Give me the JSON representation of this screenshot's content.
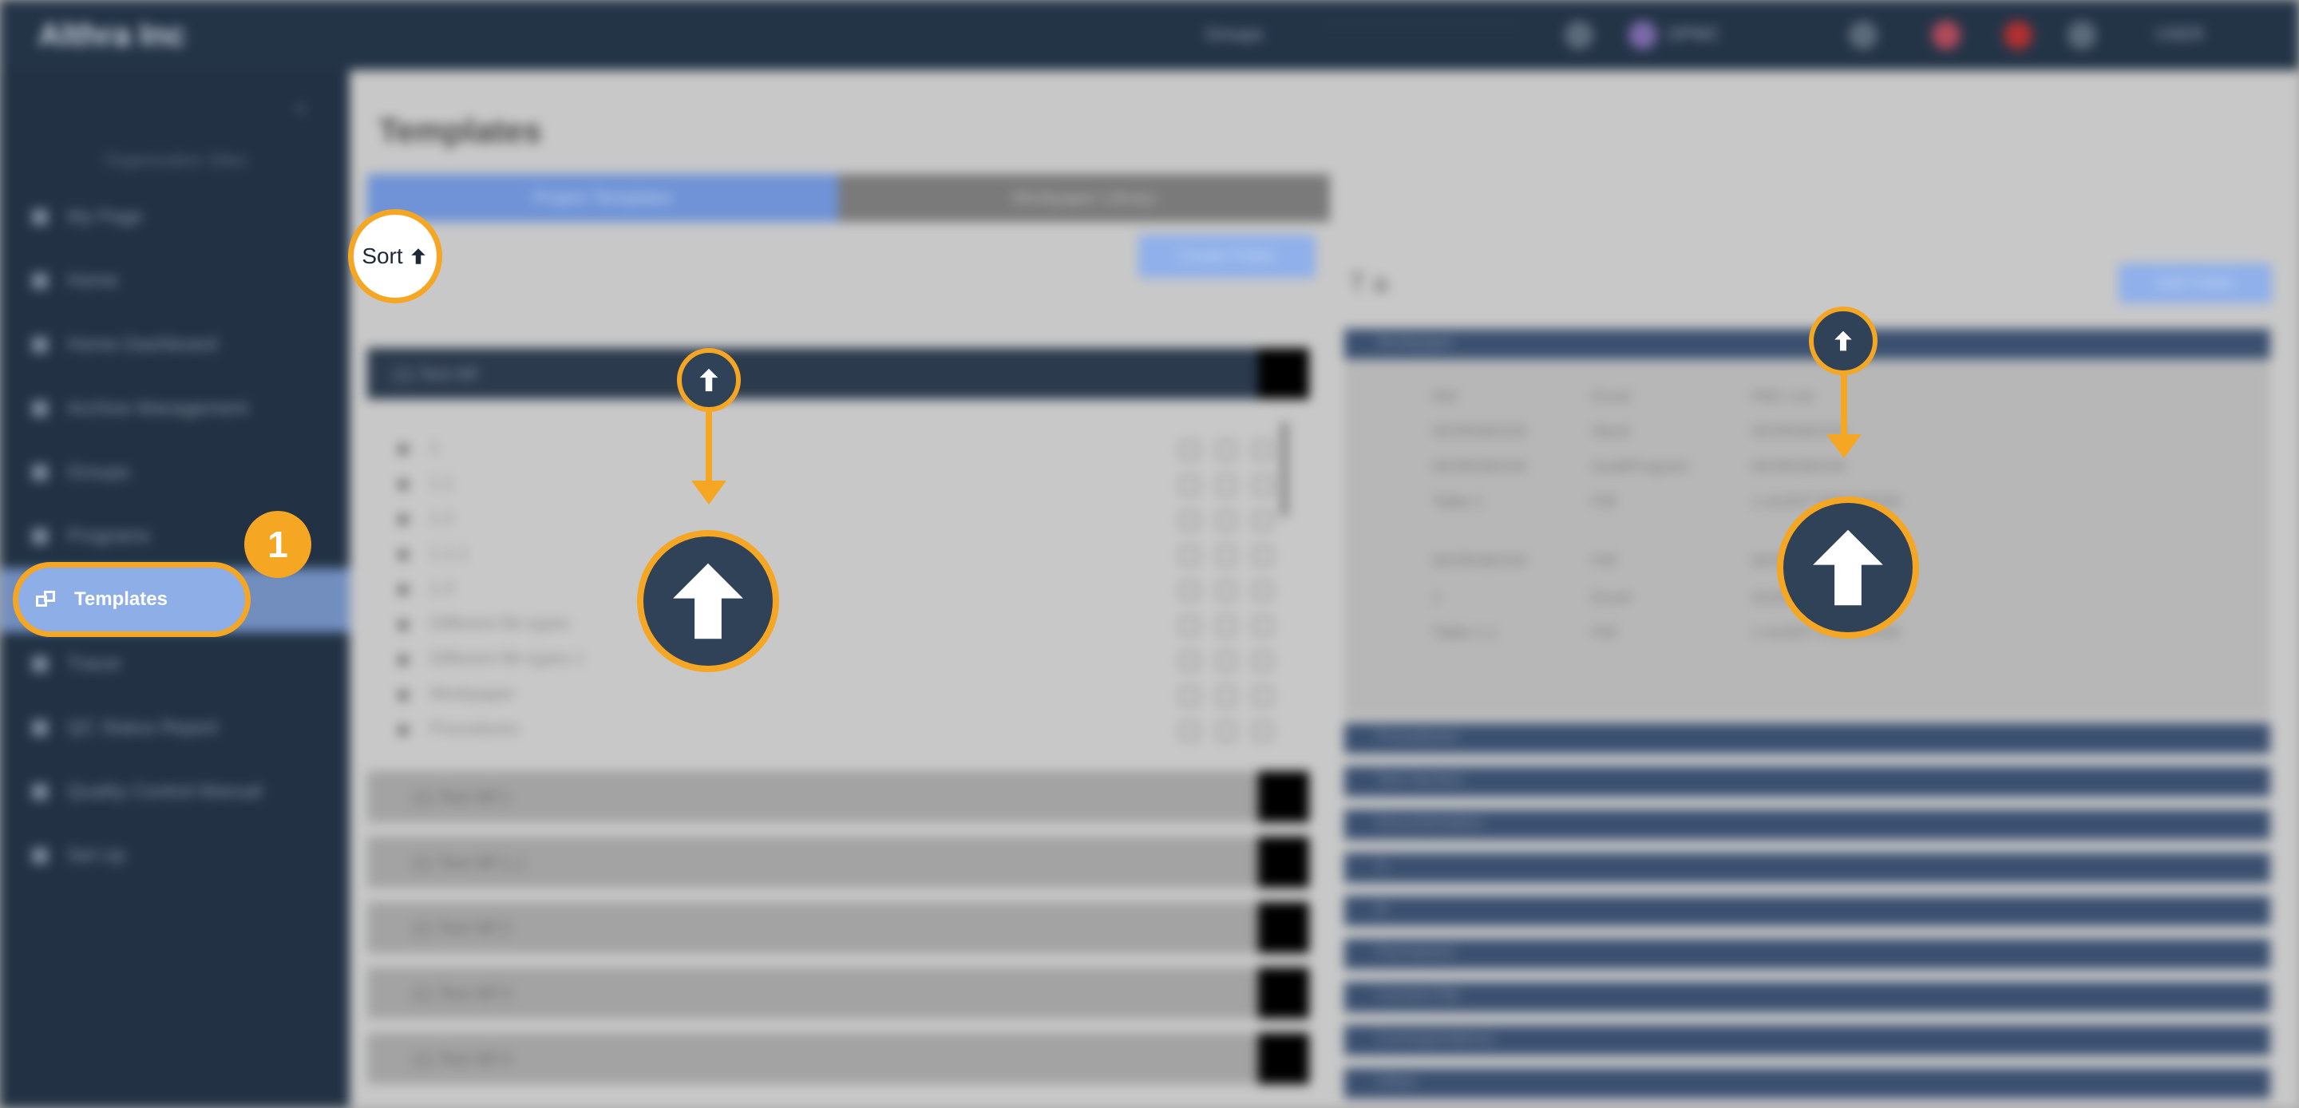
{
  "app": {
    "brand": "Althra Inc",
    "topbar": {
      "user_label": "DPMC",
      "user_menu": "USER"
    }
  },
  "sidebar": {
    "search_placeholder": "Organization Sites",
    "items": [
      {
        "label": "My Page"
      },
      {
        "label": "Home"
      },
      {
        "label": "Home Dashboard"
      },
      {
        "label": "Archive Management"
      },
      {
        "label": "Groups"
      },
      {
        "label": "Programs"
      },
      {
        "label": "Templates"
      },
      {
        "label": "Tracer"
      },
      {
        "label": "QC Status Report"
      },
      {
        "label": "Quality Control Manual"
      },
      {
        "label": "Set Up"
      }
    ],
    "active_item": "Templates"
  },
  "main": {
    "title": "Templates",
    "tabs": [
      "Project Templates",
      "Workpaper Library"
    ],
    "create_button": "Create Folder",
    "sort_callout": "Sort",
    "open_group": "(1) Test Wf",
    "list_items": [
      "1",
      "1.1",
      "1.2",
      "1.1.1",
      "1.3",
      "Different file types",
      "Different file types 1",
      "Workpaper",
      "Procedures"
    ],
    "collapsed_groups": [
      "(1) Test Wf 1",
      "(1) Test Wf 1.1",
      "(1) Test Wf 2",
      "(1) Test Wf 3",
      "(1) Test Wf 4"
    ]
  },
  "details": {
    "title": "T a",
    "add_button": "Add Folder",
    "first_section": "Workpaper",
    "rows": [
      {
        "k": "Ref",
        "t": "Excel",
        "v": "PBC List"
      },
      {
        "k": "WORKBOOK",
        "t": "Word",
        "v": "WORKBOOK"
      },
      {
        "k": "WORKBOOK",
        "t": "AuditProgram",
        "v": "WORKBOOK"
      },
      {
        "k": "Table 1",
        "t": "Pdf",
        "v": "1-AUDIT PROGRAM"
      },
      {
        "k": "WORKBOOK",
        "t": "Pdf",
        "v": "WORKBOOK"
      },
      {
        "k": "1",
        "t": "Excel",
        "v": "AUDIT"
      },
      {
        "k": "Table 1.1",
        "t": "Pdf",
        "v": "1-AUDIT PROGRAM"
      }
    ],
    "sections": [
      "Procedures",
      "Test Section",
      "Documentation",
      "A",
      "B",
      "Permanent",
      "Current File",
      "Correspondence",
      "Other"
    ]
  },
  "annotations": {
    "step_number": "1",
    "accent_color": "#f5a623"
  }
}
